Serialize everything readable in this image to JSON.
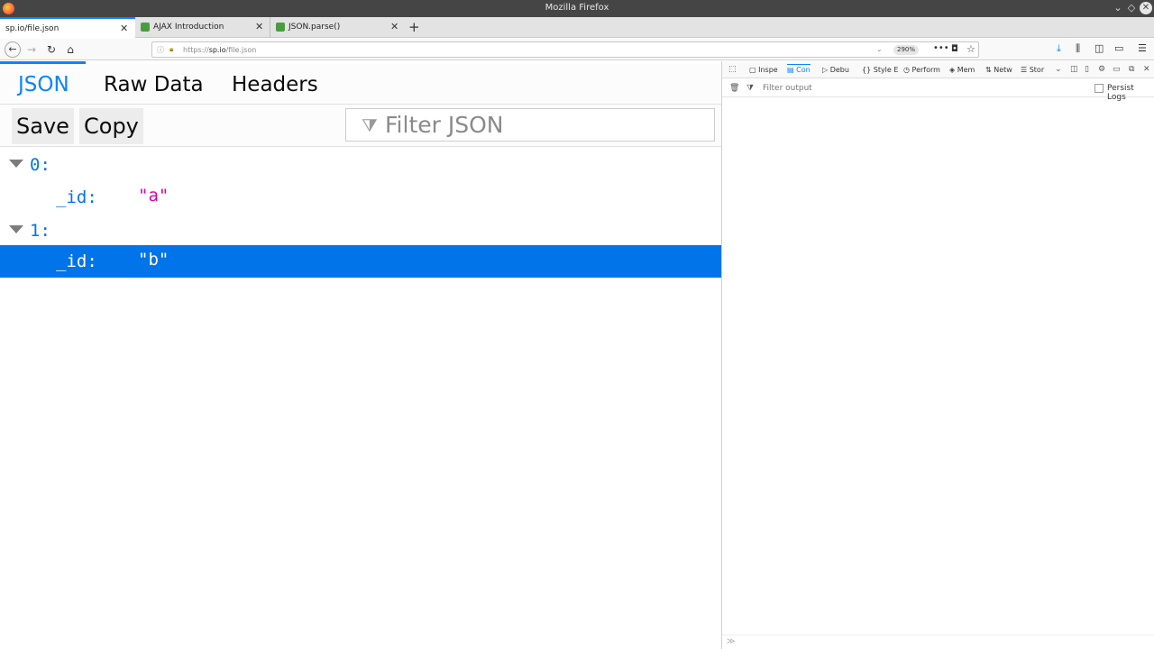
{
  "window": {
    "title": "Mozilla Firefox"
  },
  "tabs": [
    {
      "label": "sp.io/file.json"
    },
    {
      "label": "AJAX Introduction"
    },
    {
      "label": "JSON.parse()"
    }
  ],
  "navbar": {
    "url_scheme": "https://",
    "url_host": "sp.io",
    "url_path": "/file.json",
    "zoom": "290%"
  },
  "viewer": {
    "tabs": [
      "JSON",
      "Raw Data",
      "Headers"
    ],
    "save_label": "Save",
    "copy_label": "Copy",
    "filter_placeholder": "Filter JSON",
    "rows": [
      {
        "key": "0:",
        "value": ""
      },
      {
        "key": "_id:",
        "value": "\"a\""
      },
      {
        "key": "1:",
        "value": ""
      },
      {
        "key": "_id:",
        "value": "\"b\""
      }
    ]
  },
  "devtools": {
    "tabs": [
      "Inspe",
      "Con",
      "Debu",
      "Style E",
      "Perform",
      "Mem",
      "Netw",
      "Stor"
    ],
    "filter_placeholder": "Filter output",
    "persist_logs": "Persist Logs"
  },
  "colors": {
    "accent": "#0a84ff",
    "selected_row": "#0074e8",
    "json_key": "#0074e8",
    "json_string": "#dd00a9"
  }
}
